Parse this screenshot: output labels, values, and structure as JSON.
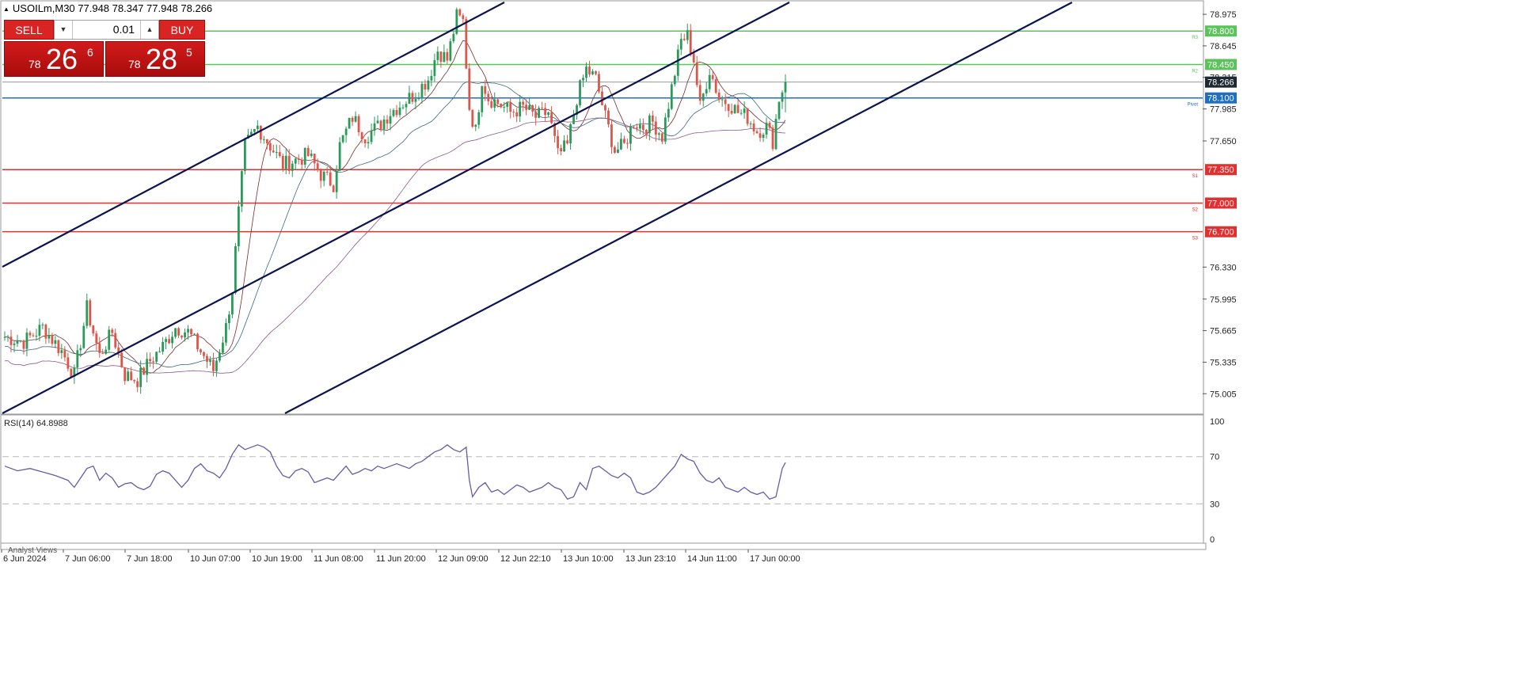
{
  "header": {
    "symbol_line": "USOILm,M30  77.948 78.347 77.948 78.266"
  },
  "trade_panel": {
    "sell_label": "SELL",
    "buy_label": "BUY",
    "lot_value": "0.01",
    "sell_quote": {
      "small": "78",
      "big": "26",
      "sup": "6"
    },
    "buy_quote": {
      "small": "78",
      "big": "28",
      "sup": "5"
    }
  },
  "colors": {
    "resistance": "#5cc35c",
    "support": "#e03030",
    "pivot": "#1f6fc0",
    "channel": "#0b1350",
    "bull": "#2a9a5a",
    "bear": "#e0554a",
    "rsi": "#6a5aa8",
    "ma_fast": "#7a2a2a",
    "ma_mid": "#3a6a7a",
    "ma_slow": "#8a5a8a"
  },
  "chart_data": [
    {
      "type": "candlestick",
      "title": "USOILm,M30",
      "ohlc_current": {
        "open": 77.948,
        "high": 78.347,
        "low": 77.948,
        "close": 78.266
      },
      "ylim": [
        74.8,
        79.1
      ],
      "y_ticks": [
        "78.975",
        "78.645",
        "78.315",
        "77.985",
        "77.650",
        "76.330",
        "75.995",
        "75.665",
        "75.335",
        "75.005"
      ],
      "x_ticks": [
        "6 Jun 2024",
        "7 Jun 06:00",
        "7 Jun 18:00",
        "10 Jun 07:00",
        "10 Jun 19:00",
        "11 Jun 08:00",
        "11 Jun 20:00",
        "12 Jun 09:00",
        "12 Jun 22:10",
        "13 Jun 10:00",
        "13 Jun 23:10",
        "14 Jun 11:00",
        "17 Jun 00:00"
      ],
      "current_price": "78.266",
      "levels": [
        {
          "label": "R3",
          "value": 78.8,
          "text": "78.800",
          "kind": "resistance"
        },
        {
          "label": "R2",
          "value": 78.45,
          "text": "78.450",
          "kind": "resistance"
        },
        {
          "label": "Pivot",
          "value": 78.1,
          "text": "78.100",
          "kind": "pivot"
        },
        {
          "label": "S1",
          "value": 77.35,
          "text": "77.350",
          "kind": "support"
        },
        {
          "label": "S2",
          "value": 77.0,
          "text": "77.000",
          "kind": "support"
        },
        {
          "label": "S3",
          "value": 76.7,
          "text": "76.700",
          "kind": "support"
        }
      ],
      "price_path": [
        [
          0,
          75.6
        ],
        [
          6,
          75.55
        ],
        [
          12,
          75.7
        ],
        [
          18,
          75.45
        ],
        [
          22,
          75.2
        ],
        [
          26,
          75.9
        ],
        [
          30,
          75.4
        ],
        [
          34,
          75.65
        ],
        [
          38,
          75.2
        ],
        [
          42,
          75.15
        ],
        [
          46,
          75.35
        ],
        [
          50,
          75.5
        ],
        [
          54,
          75.7
        ],
        [
          58,
          75.65
        ],
        [
          62,
          75.45
        ],
        [
          66,
          75.25
        ],
        [
          70,
          75.7
        ],
        [
          72,
          76.1
        ],
        [
          74,
          76.9
        ],
        [
          76,
          77.6
        ],
        [
          80,
          77.8
        ],
        [
          84,
          77.6
        ],
        [
          88,
          77.4
        ],
        [
          92,
          77.45
        ],
        [
          96,
          77.5
        ],
        [
          100,
          77.3
        ],
        [
          104,
          77.2
        ],
        [
          106,
          77.6
        ],
        [
          110,
          77.9
        ],
        [
          114,
          77.7
        ],
        [
          118,
          77.8
        ],
        [
          122,
          77.95
        ],
        [
          126,
          78.05
        ],
        [
          130,
          78.15
        ],
        [
          134,
          78.3
        ],
        [
          137,
          78.6
        ],
        [
          140,
          78.5
        ],
        [
          143,
          78.95
        ],
        [
          145,
          78.9
        ],
        [
          147,
          78.0
        ],
        [
          149,
          77.75
        ],
        [
          151,
          78.3
        ],
        [
          153,
          78.1
        ],
        [
          156,
          78.05
        ],
        [
          160,
          77.95
        ],
        [
          164,
          78.0
        ],
        [
          168,
          77.9
        ],
        [
          172,
          77.95
        ],
        [
          175,
          77.5
        ],
        [
          178,
          77.6
        ],
        [
          181,
          78.1
        ],
        [
          184,
          78.4
        ],
        [
          187,
          78.3
        ],
        [
          190,
          77.9
        ],
        [
          193,
          77.55
        ],
        [
          196,
          77.6
        ],
        [
          199,
          77.85
        ],
        [
          202,
          77.8
        ],
        [
          205,
          77.85
        ],
        [
          208,
          77.7
        ],
        [
          211,
          78.2
        ],
        [
          214,
          78.7
        ],
        [
          216,
          78.75
        ],
        [
          218,
          78.5
        ],
        [
          220,
          78.0
        ],
        [
          223,
          78.4
        ],
        [
          226,
          78.1
        ],
        [
          229,
          78.05
        ],
        [
          232,
          77.95
        ],
        [
          235,
          77.9
        ],
        [
          238,
          77.75
        ],
        [
          241,
          77.8
        ],
        [
          243,
          77.65
        ],
        [
          245,
          78.1
        ],
        [
          247,
          78.27
        ]
      ],
      "moving_averages": [
        "ma_fast",
        "ma_mid",
        "ma_slow"
      ],
      "channel": "ascending, 3 parallel lines"
    },
    {
      "type": "line",
      "title": "RSI(14) 64.8988",
      "ylim": [
        0,
        100
      ],
      "y_ticks": [
        "100",
        "70",
        "30",
        "0"
      ],
      "levels": [
        70,
        30
      ],
      "values": [
        [
          0,
          62
        ],
        [
          4,
          58
        ],
        [
          8,
          60
        ],
        [
          12,
          57
        ],
        [
          16,
          54
        ],
        [
          20,
          50
        ],
        [
          22,
          44
        ],
        [
          24,
          52
        ],
        [
          26,
          60
        ],
        [
          28,
          62
        ],
        [
          30,
          50
        ],
        [
          32,
          56
        ],
        [
          34,
          52
        ],
        [
          36,
          44
        ],
        [
          38,
          47
        ],
        [
          40,
          48
        ],
        [
          42,
          44
        ],
        [
          44,
          42
        ],
        [
          46,
          45
        ],
        [
          48,
          55
        ],
        [
          50,
          58
        ],
        [
          52,
          56
        ],
        [
          54,
          50
        ],
        [
          56,
          44
        ],
        [
          58,
          50
        ],
        [
          60,
          60
        ],
        [
          62,
          64
        ],
        [
          64,
          58
        ],
        [
          66,
          56
        ],
        [
          68,
          52
        ],
        [
          70,
          60
        ],
        [
          72,
          72
        ],
        [
          74,
          80
        ],
        [
          76,
          76
        ],
        [
          78,
          78
        ],
        [
          80,
          80
        ],
        [
          82,
          78
        ],
        [
          84,
          74
        ],
        [
          86,
          62
        ],
        [
          88,
          54
        ],
        [
          90,
          52
        ],
        [
          92,
          58
        ],
        [
          94,
          60
        ],
        [
          96,
          57
        ],
        [
          98,
          48
        ],
        [
          100,
          50
        ],
        [
          102,
          52
        ],
        [
          104,
          50
        ],
        [
          106,
          56
        ],
        [
          108,
          62
        ],
        [
          110,
          55
        ],
        [
          112,
          57
        ],
        [
          114,
          60
        ],
        [
          116,
          58
        ],
        [
          118,
          62
        ],
        [
          120,
          60
        ],
        [
          122,
          62
        ],
        [
          124,
          64
        ],
        [
          126,
          62
        ],
        [
          128,
          60
        ],
        [
          130,
          64
        ],
        [
          132,
          66
        ],
        [
          134,
          70
        ],
        [
          136,
          74
        ],
        [
          138,
          76
        ],
        [
          140,
          80
        ],
        [
          142,
          76
        ],
        [
          144,
          74
        ],
        [
          146,
          78
        ],
        [
          147,
          50
        ],
        [
          148,
          36
        ],
        [
          150,
          44
        ],
        [
          152,
          48
        ],
        [
          154,
          40
        ],
        [
          156,
          42
        ],
        [
          158,
          38
        ],
        [
          160,
          42
        ],
        [
          162,
          46
        ],
        [
          164,
          44
        ],
        [
          166,
          40
        ],
        [
          168,
          42
        ],
        [
          170,
          44
        ],
        [
          172,
          48
        ],
        [
          174,
          44
        ],
        [
          176,
          42
        ],
        [
          178,
          34
        ],
        [
          180,
          36
        ],
        [
          182,
          48
        ],
        [
          184,
          42
        ],
        [
          186,
          60
        ],
        [
          188,
          62
        ],
        [
          190,
          58
        ],
        [
          192,
          54
        ],
        [
          194,
          52
        ],
        [
          196,
          56
        ],
        [
          198,
          52
        ],
        [
          200,
          40
        ],
        [
          202,
          38
        ],
        [
          204,
          40
        ],
        [
          206,
          44
        ],
        [
          208,
          50
        ],
        [
          210,
          56
        ],
        [
          212,
          62
        ],
        [
          214,
          72
        ],
        [
          216,
          68
        ],
        [
          218,
          66
        ],
        [
          220,
          56
        ],
        [
          222,
          50
        ],
        [
          224,
          48
        ],
        [
          226,
          52
        ],
        [
          228,
          44
        ],
        [
          230,
          42
        ],
        [
          232,
          40
        ],
        [
          234,
          44
        ],
        [
          236,
          40
        ],
        [
          238,
          38
        ],
        [
          240,
          40
        ],
        [
          242,
          34
        ],
        [
          244,
          36
        ],
        [
          246,
          60
        ],
        [
          247,
          65
        ]
      ]
    }
  ],
  "bottom_tab": "Analyst Views"
}
